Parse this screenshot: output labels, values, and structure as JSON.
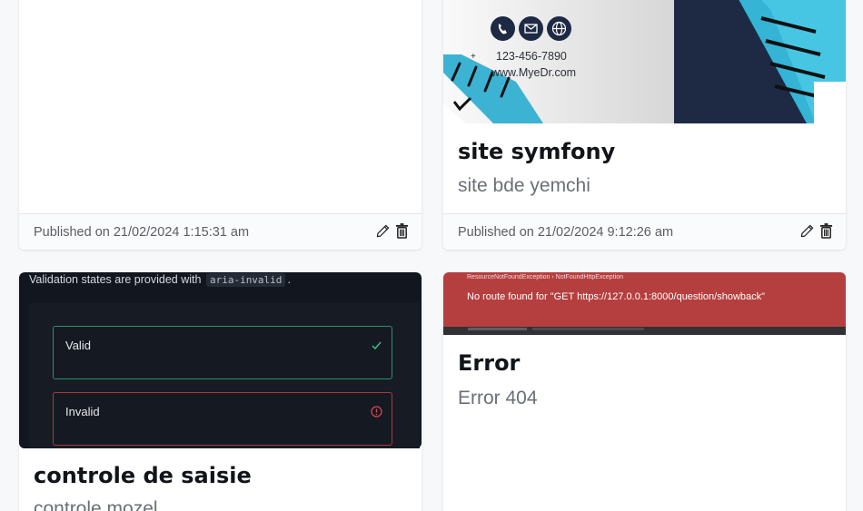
{
  "cards": [
    {
      "published": "Published on 21/02/2024 1:15:31 am"
    },
    {
      "title": "site symfony",
      "subtitle": "site bde yemchi",
      "published": "Published on 21/02/2024 9:12:26 am",
      "image": {
        "phone": "123-456-7890",
        "website": "www.MyeDr.com",
        "plus": "+",
        "icons": [
          "phone-icon",
          "mail-icon",
          "globe-icon"
        ]
      }
    },
    {
      "title": "controle de saisie",
      "subtitle": "controle mozel",
      "image": {
        "header_text": "Validation states are provided with",
        "header_code": "aria-invalid",
        "header_end": ".",
        "valid_label": "Valid",
        "invalid_label": "Invalid"
      }
    },
    {
      "title": "Error",
      "subtitle": "Error 404",
      "image": {
        "exception": "ResourceNotFoundException  ›  NotFoundHttpException",
        "message": "No route found for \"GET https://127.0.0.1:8000/question/showback\""
      }
    }
  ],
  "icons": {
    "edit": "pencil-icon",
    "delete": "trash-icon"
  },
  "colors": {
    "title": "#111418",
    "valid_border": "#2f8f6b",
    "invalid_border": "#a83a3f",
    "error_bg": "#b53f3f",
    "navy": "#1e2a44"
  }
}
